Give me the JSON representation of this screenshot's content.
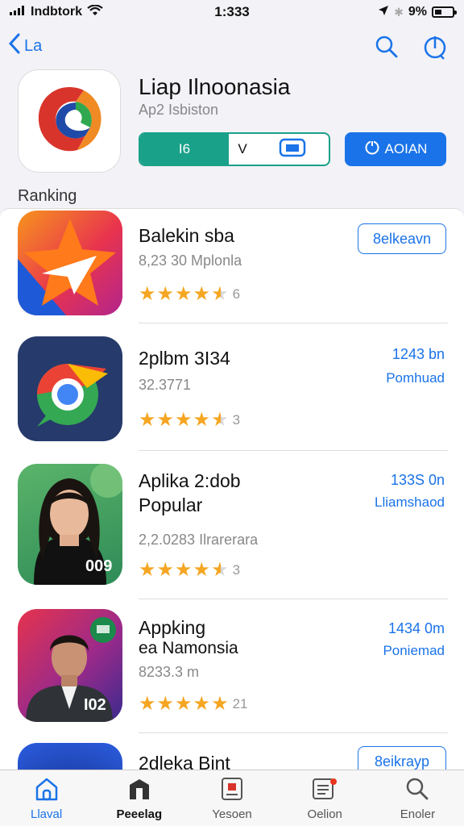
{
  "status_bar": {
    "carrier": "Indbtork",
    "time": "1:333",
    "battery": "9%"
  },
  "nav": {
    "back_label": "La",
    "search_icon": "search-icon",
    "share_icon": "info-icon"
  },
  "app": {
    "title": "Liap Ilnoonasia",
    "subtitle": "Ap2 Isbiston",
    "segment_left": "I6",
    "segment_mid": "V",
    "segment_icon": "document-icon",
    "action_label": "AOIAN"
  },
  "section": {
    "label": "Ranking"
  },
  "list": [
    {
      "title": "Balekin sba",
      "meta": "8,23 30 Mplonla",
      "rating": 4.5,
      "rating_text": "6",
      "button": "8elkeavn"
    },
    {
      "title": "2plbm 3I34",
      "meta": "32.3771",
      "rating": 4.5,
      "rating_text": "3",
      "size": "1243 bn",
      "status": "Pomhuad"
    },
    {
      "title_line1": "Aplika 2:dob",
      "title_line2": "Popular",
      "meta": "2,2.0283 Ilrarerara",
      "rating": 4.5,
      "rating_text": "3",
      "size": "133S 0n",
      "status": "Lliamshaod",
      "badge": "009"
    },
    {
      "title_line1": "Appking",
      "title_line2": "ea Namonsia",
      "meta": "8233.3 m",
      "rating": 5,
      "rating_text": "21",
      "size": "1434 0m",
      "status": "Poniemad",
      "badge": "I02"
    },
    {
      "title": "2dleka Bint",
      "button": "8eikrayp"
    }
  ],
  "tabs": [
    {
      "label": "Llaval",
      "icon": "home-icon"
    },
    {
      "label": "Peeelag",
      "icon": "ranking-icon"
    },
    {
      "label": "Yesoen",
      "icon": "news-icon"
    },
    {
      "label": "Oelion",
      "icon": "list-icon"
    },
    {
      "label": "Enoler",
      "icon": "search-icon"
    }
  ],
  "colors": {
    "accent": "#1a73e8",
    "green": "#1aa18a",
    "star": "#f5a623"
  }
}
